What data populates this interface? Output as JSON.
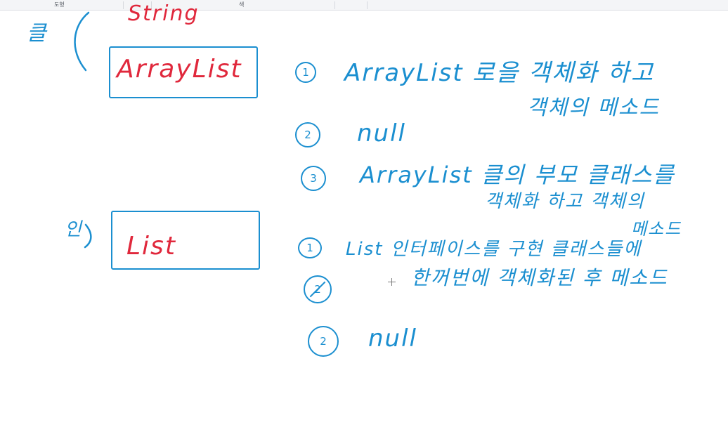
{
  "ribbon": {
    "shapes_label": "도형",
    "color_label": "색"
  },
  "canvas": {
    "class_label": "클",
    "string_text": "String",
    "arraylist_text": "ArrayList",
    "interface_label": "인",
    "list_text": "List",
    "group1": {
      "item1_num": "1",
      "item1_line1": "ArrayList 로을 객체화 하고",
      "item1_line2": "객체의 메소드",
      "item2_num": "2",
      "item2_text": "null",
      "item3_num": "3",
      "item3_line1": "ArrayList 클의 부모 클래스를",
      "item3_line2": "객체화 하고 객체의",
      "item3_line3": "메소드"
    },
    "group2": {
      "item1_num": "1",
      "item1_line1": "List 인터페이스를 구현 클래스들에",
      "item1_line2": "한꺼번에 객체화된 후 메소드",
      "item2_num": "2",
      "item3_num": "2",
      "item3_text": "null"
    }
  },
  "colors": {
    "pen_blue": "#1b8fd0",
    "pen_red": "#e0283c"
  }
}
